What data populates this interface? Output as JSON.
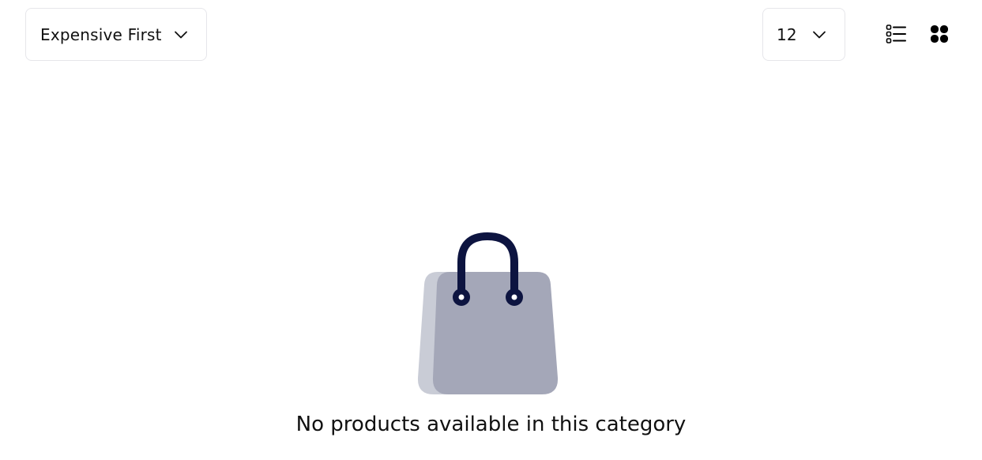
{
  "toolbar": {
    "sort": {
      "selected": "Expensive First"
    },
    "per_page": {
      "selected": "12"
    },
    "view_toggle": {
      "list_icon": "list-view-icon",
      "grid_icon": "grid-view-icon"
    }
  },
  "empty_state": {
    "icon": "shopping-bag-icon",
    "message": "No products available in this category"
  },
  "colors": {
    "border": "#e6e6ea",
    "bag_back": "#c9ccd6",
    "bag_front": "#a4a7b8",
    "bag_handle": "#0d1440",
    "text": "#111111"
  }
}
